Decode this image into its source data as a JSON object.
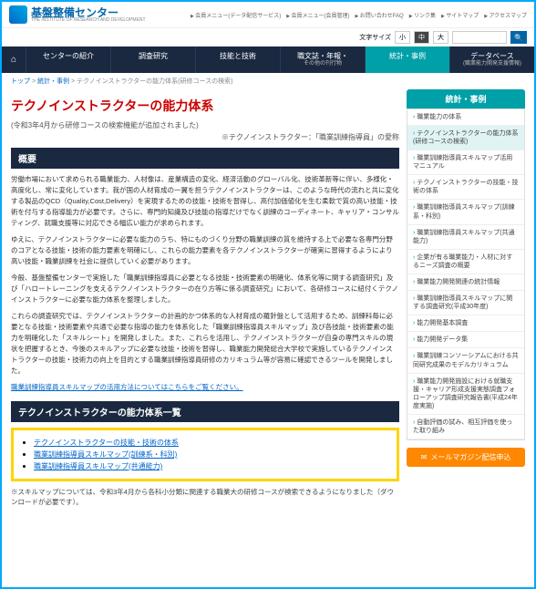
{
  "header": {
    "logo_title": "基盤整備センター",
    "logo_sub": "THE INSTITUTE OF RESEARCH AND DEVELOPMENT",
    "top_links": [
      "会員メニュー(データ配信サービス)",
      "会員メニュー(会員管理)",
      "お問い合わせFAQ",
      "リンク集",
      "サイトマップ",
      "アクセスマップ"
    ],
    "font_label": "文字サイズ",
    "sizes": [
      "小",
      "中",
      "大"
    ]
  },
  "nav": {
    "items": [
      {
        "label": "センターの紹介",
        "sub": ""
      },
      {
        "label": "調査研究",
        "sub": ""
      },
      {
        "label": "技能と技術",
        "sub": ""
      },
      {
        "label": "職文誌・年報・",
        "sub": "その他の刊行物"
      },
      {
        "label": "統計・事例",
        "sub": ""
      },
      {
        "label": "データベース",
        "sub": "(職業能力開発支援情報)"
      }
    ]
  },
  "breadcrumb": {
    "items": [
      "トップ",
      "統計・事例"
    ],
    "current": "テクノインストラクターの能力体系(研修コースの検索)"
  },
  "page": {
    "title": "テクノインストラクターの能力体系",
    "subtitle": "(令和3年4月から研修コースの検索機能が追加されました)",
    "note": "※テクノインストラクター：「職業訓練指導員」の愛称"
  },
  "sections": {
    "overview_hdr": "概要",
    "p1": "労働市場において求められる職業能力、人材像は、産業構造の変化、経済活動のグローバル化、技術革新等に伴い、多様化・高度化し、常に変化しています。我が国の人材育成の一翼を担うテクノインストラクターは、このような時代の流れと共に変化する製品のQCD（Quality,Cost,Delivery）を実現するための技能・技術を習得し、高付加価値化を生む柔軟で質の高い技能・技術を付与する指導能力が必要です。さらに、専門的知識及び技能の指導だけでなく訓練のコーディネート、キャリア・コンサルティング、就職支援等に対応できる幅広い能力が求められます。",
    "p2": "ゆえに、テクノインストラクターに必要な能力のうち、特にものづくり分野の職業訓練の質を維持する上で必要な各専門分野のコアとなる技能・技術の能力要素を明確にし、これらの能力要素を各テクノインストラクターが確実に習得するようにより高い技能・職業訓練を社会に提供していく必要があります。",
    "p3": "今般、基盤整備センターで実施した「職業訓練指導員に必要となる技能・技術要素の明確化、体系化等に関する調査研究」及び「ハロートレーニングを支えるテクノインストラクターの在り方等に係る調査研究」において、各研修コースに紐付くテクノインストラクターに必要な能力体系を整理しました。",
    "p4": "これらの調査研究では、テクノインストラクターの計画的かつ体系的な人材育成の羅針盤として活用するため、訓練科毎に必要となる技能・技術要素や共通で必要な指導の能力を体系化した「職業訓練指導員スキルマップ」及び各技能・技術要素の能力を明確化した「スキルシート」を開発しました。また、これらを活用し、テクノインストラクターが自身の専門スキルの現状を把握するとき、今後のスキルアップに必要な技能・技術を習得し、職業能力開発総合大学校で実施しているテクノインストラクターの技能・技術力の向上を目的とする職業訓練指導員研修のカリキュラム等が容易に確認できるツールを開発しました。",
    "link1": "職業訓練指導員スキルマップの活用方法についてはこちらをご覧ください。",
    "list_hdr": "テクノインストラクターの能力体系一覧",
    "list_items": [
      "テクノインストラクターの技能・技術の体系",
      "職業訓練指導員スキルマップ(訓練系・科別)",
      "職業訓練指導員スキルマップ(共通能力)"
    ],
    "foot_note": "※スキルマップについては、令和3年4月から各科小分類に関連する職業大の研修コースが検索できるようになりました（ダウンロードが必要です）。"
  },
  "sidebar": {
    "header": "統計・事例",
    "items": [
      "職業能力の体系",
      "テクノインストラクターの能力体系(研修コースの検索)",
      "職業訓練指導員スキルマップ活用マニュアル",
      "テクノインストラクターの技能・技術の体系",
      "職業訓練指導員スキルマップ(訓練系・科別)",
      "職業訓練指導員スキルマップ(共通能力)",
      "企業が有る職業能力・人材に対するニーズ調査の概要",
      "職業能力開発関連の統計情報",
      "職業訓練指導員スキルマップに関する調査研究(平成30年度)",
      "能力開発基本調査",
      "能力開発データ集",
      "職業訓練コンソーシアムにおける共同研究成果のモデルカリキュラム",
      "職業能力開発施設における就職支援・キャリア形成支援実態調査フォローアップ調査研究報告書(平成24年度実施)",
      "自動評価の試み、相互評価を使った取り組み"
    ],
    "mail_btn": "メールマガジン配信申込"
  }
}
